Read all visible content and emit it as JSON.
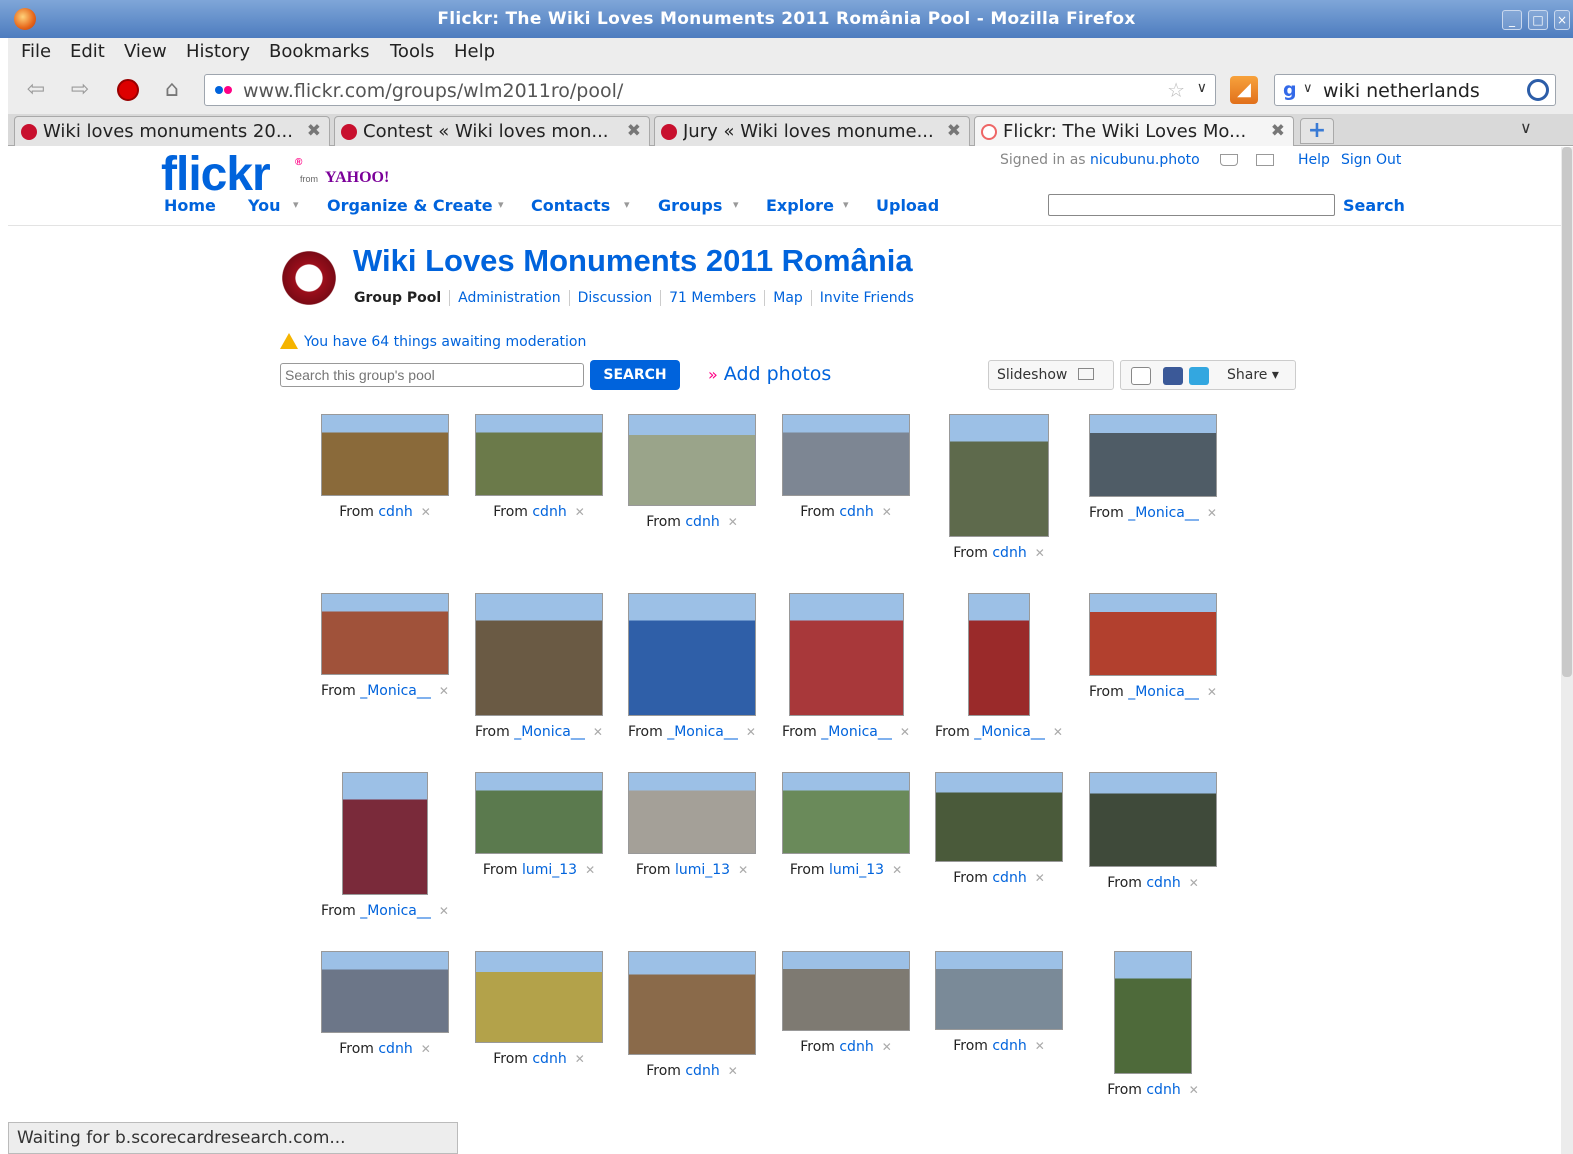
{
  "window": {
    "title": "Flickr: The Wiki Loves Monuments 2011 România Pool - Mozilla Firefox",
    "controls": [
      "_",
      "□",
      "×"
    ]
  },
  "menu": [
    "File",
    "Edit",
    "View",
    "History",
    "Bookmarks",
    "Tools",
    "Help"
  ],
  "toolbar": {
    "url": "www.flickr.com/groups/wlm2011ro/pool/",
    "search_value": "wiki netherlands"
  },
  "tabs": [
    {
      "label": "Wiki loves monuments 20...",
      "active": false
    },
    {
      "label": "Contest « Wiki loves mon...",
      "active": false
    },
    {
      "label": "Jury « Wiki loves monume...",
      "active": false
    },
    {
      "label": "Flickr: The Wiki Loves Mo...",
      "active": true
    }
  ],
  "flickr": {
    "logo_text": "flickr",
    "logo_from": "from",
    "logo_yahoo": "YAHOO!",
    "signed_in_prefix": "Signed in as",
    "username": "nicubunu.photo",
    "help": "Help",
    "sign_out": "Sign Out",
    "nav": [
      "Home",
      "You",
      "Organize & Create",
      "Contacts",
      "Groups",
      "Explore",
      "Upload"
    ],
    "search_button": "Search"
  },
  "group": {
    "title": "Wiki Loves Monuments 2011 România",
    "tabs": [
      "Group Pool",
      "Administration",
      "Discussion",
      "71 Members",
      "Map",
      "Invite Friends"
    ],
    "moderation_note": "You have 64 things awaiting moderation",
    "pool_search_placeholder": "Search this group's pool",
    "pool_search_button": "SEARCH",
    "add_photos": "Add photos",
    "add_arrow": "»",
    "slideshow": "Slideshow",
    "share": "Share"
  },
  "photos": [
    {
      "from": "From",
      "by": "cdnh",
      "fill": "#8a6a3a"
    },
    {
      "from": "From",
      "by": "cdnh",
      "fill": "#6b7a4a"
    },
    {
      "from": "From",
      "by": "cdnh",
      "fill": "#9aa48a"
    },
    {
      "from": "From",
      "by": "cdnh",
      "fill": "#7d8693"
    },
    {
      "from": "From",
      "by": "cdnh",
      "fill": "#5e6a4c"
    },
    {
      "from": "From",
      "by": "_Monica__",
      "fill": "#4f5c66"
    },
    {
      "from": "From",
      "by": "_Monica__",
      "fill": "#a0523a"
    },
    {
      "from": "From",
      "by": "_Monica__",
      "fill": "#6a5a44"
    },
    {
      "from": "From",
      "by": "_Monica__",
      "fill": "#2f5fa8"
    },
    {
      "from": "From",
      "by": "_Monica__",
      "fill": "#a8383a"
    },
    {
      "from": "From",
      "by": "_Monica__",
      "fill": "#9a2a2a"
    },
    {
      "from": "From",
      "by": "_Monica__",
      "fill": "#b2402e"
    },
    {
      "from": "From",
      "by": "_Monica__",
      "fill": "#7a2a3a"
    },
    {
      "from": "From",
      "by": "lumi_13",
      "fill": "#5b7a4e"
    },
    {
      "from": "From",
      "by": "lumi_13",
      "fill": "#a4a098"
    },
    {
      "from": "From",
      "by": "lumi_13",
      "fill": "#6a8a5a"
    },
    {
      "from": "From",
      "by": "cdnh",
      "fill": "#4a5a3a"
    },
    {
      "from": "From",
      "by": "cdnh",
      "fill": "#3f4a3a"
    },
    {
      "from": "From",
      "by": "cdnh",
      "fill": "#6c7688"
    },
    {
      "from": "From",
      "by": "cdnh",
      "fill": "#b3a24a"
    },
    {
      "from": "From",
      "by": "cdnh",
      "fill": "#8a6a4a"
    },
    {
      "from": "From",
      "by": "cdnh",
      "fill": "#7e7a72"
    },
    {
      "from": "From",
      "by": "cdnh",
      "fill": "#7a8a98"
    },
    {
      "from": "From",
      "by": "cdnh",
      "fill": "#4e6a3a"
    }
  ],
  "status": "Waiting for b.scorecardresearch.com..."
}
